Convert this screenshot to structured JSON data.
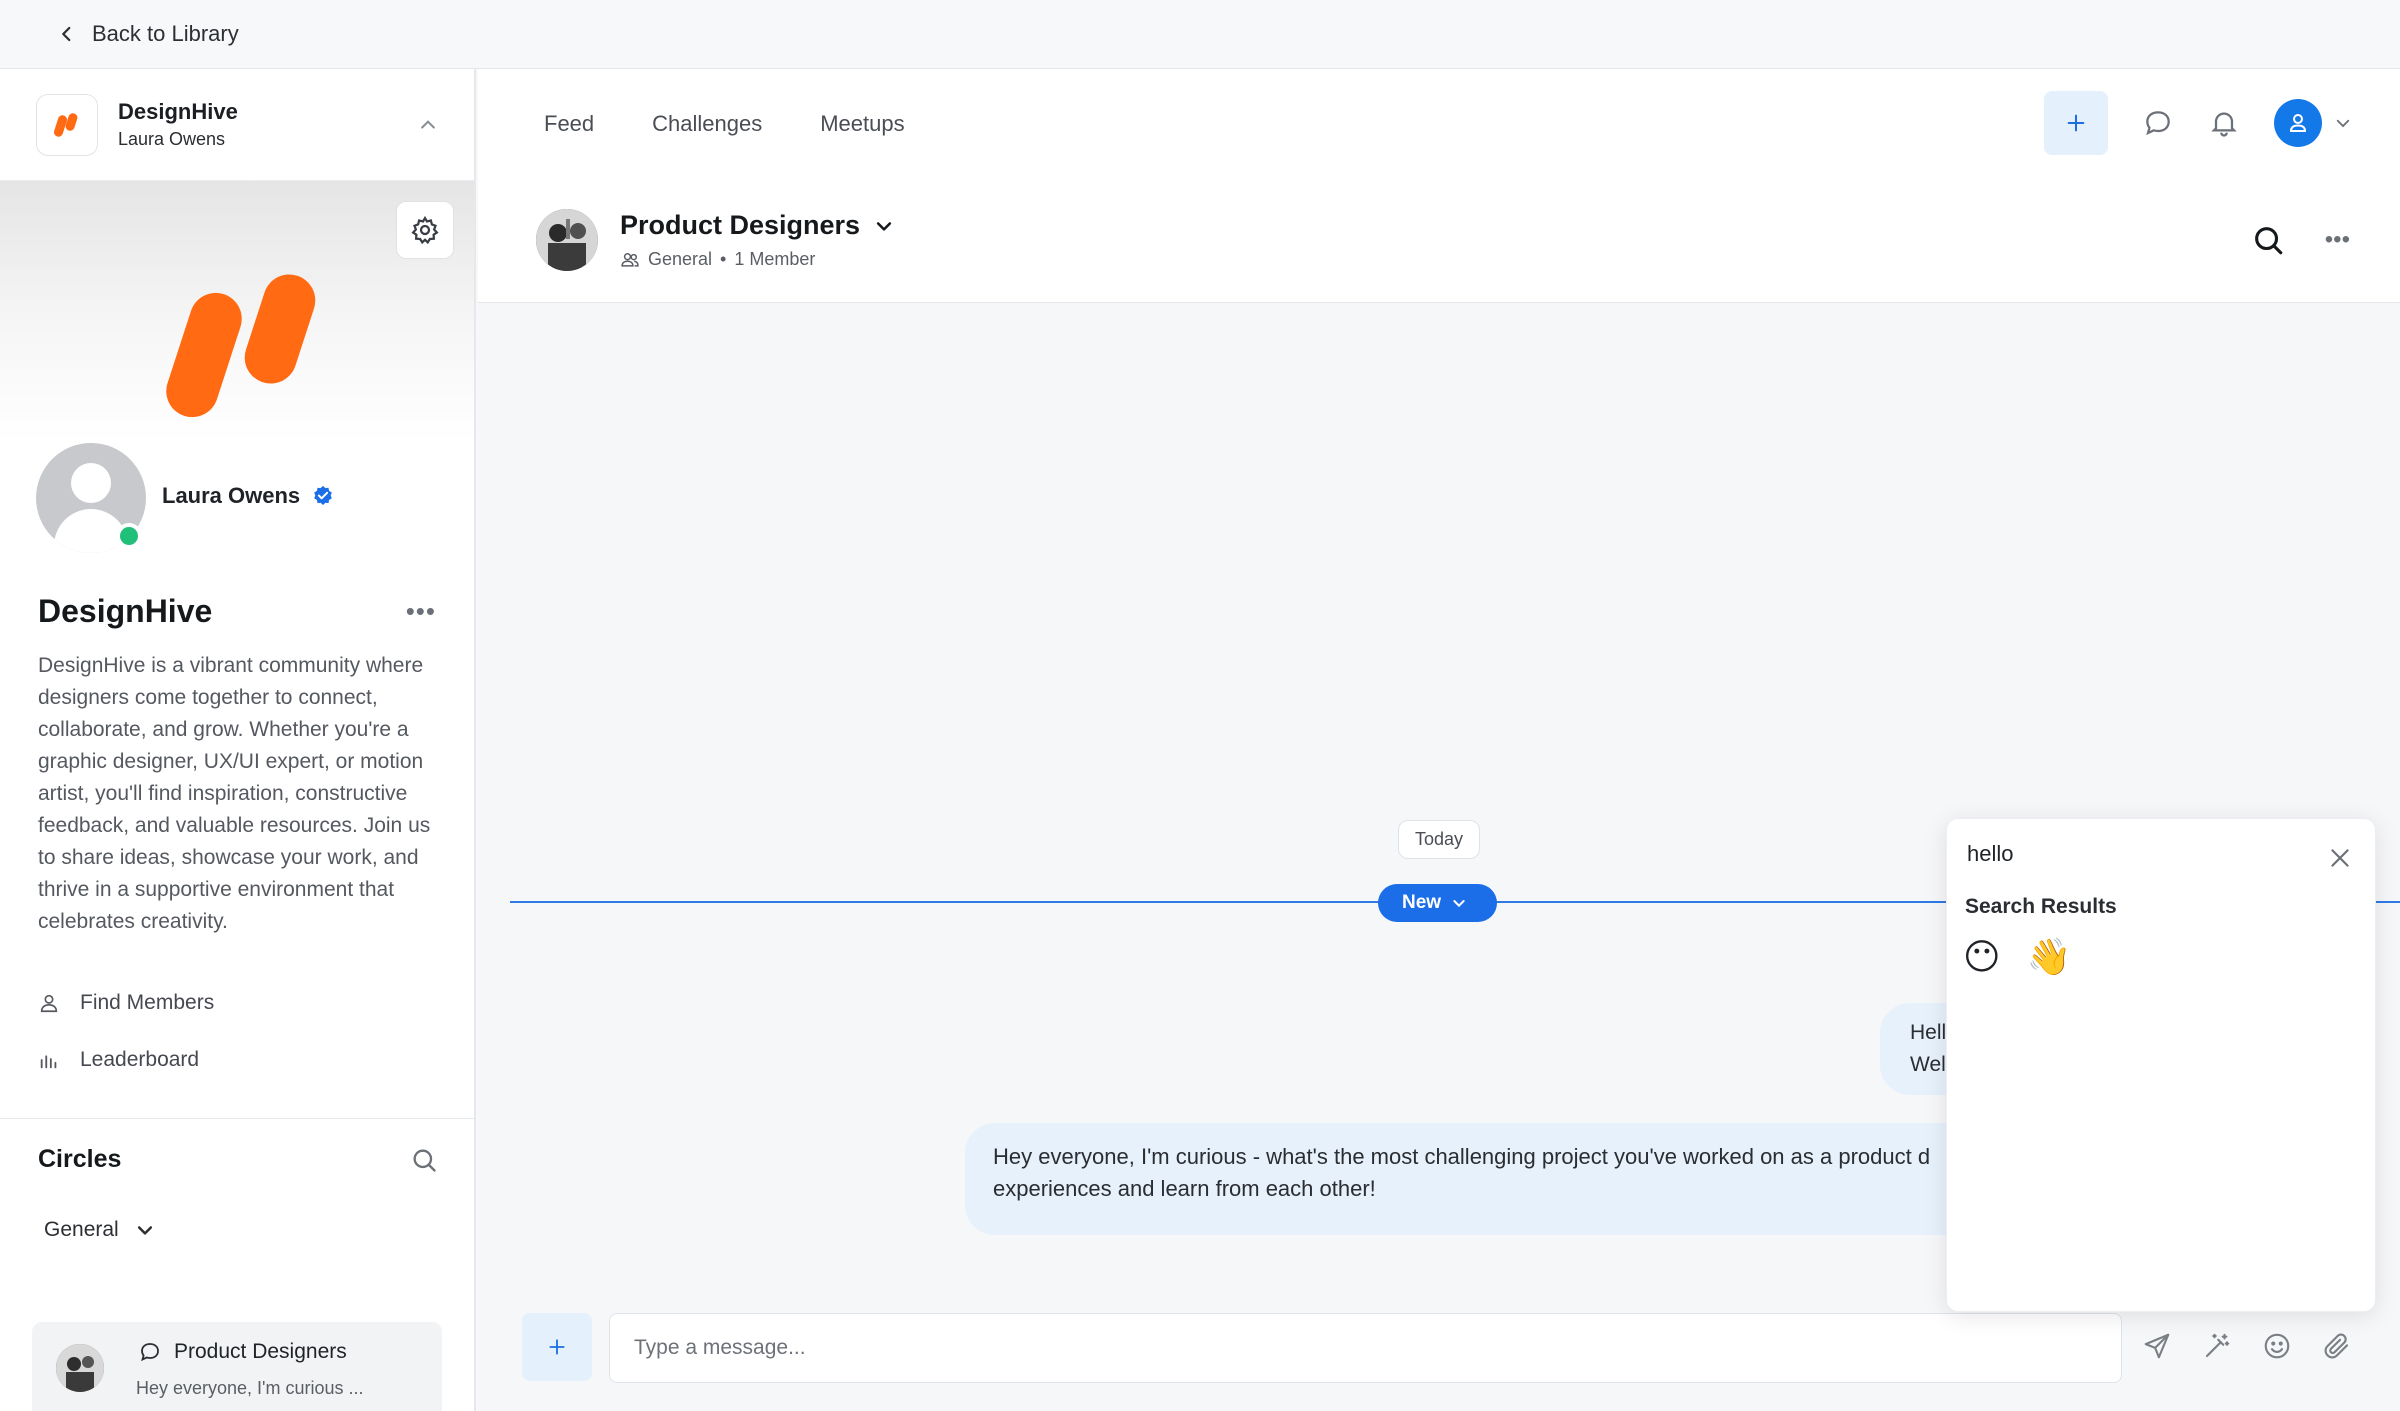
{
  "topbar": {
    "back_label": "Back to Library"
  },
  "community": {
    "name": "DesignHive",
    "user": "Laura Owens"
  },
  "profile": {
    "name": "Laura Owens"
  },
  "about": {
    "title": "DesignHive",
    "description": "DesignHive is a vibrant community where designers come together to connect, collaborate, and grow. Whether you're a graphic designer, UX/UI expert, or motion artist, you'll find inspiration, constructive feedback, and valuable resources. Join us to share ideas, showcase your work, and thrive in a supportive environment that celebrates creativity."
  },
  "links": [
    {
      "label": "Find Members",
      "icon": "person-icon"
    },
    {
      "label": "Leaderboard",
      "icon": "bar-chart-icon"
    }
  ],
  "circles": {
    "title": "Circles",
    "filter": "General",
    "items": [
      {
        "title": "Product Designers",
        "preview": "Hey everyone, I'm curious ..."
      }
    ]
  },
  "tabs": [
    "Feed",
    "Challenges",
    "Meetups"
  ],
  "channel": {
    "title": "Product Designers",
    "category": "General",
    "members": "1 Member"
  },
  "chat": {
    "date_label": "Today",
    "new_label": "New",
    "messages": [
      {
        "line1": "Hell",
        "line2": "Wel"
      },
      {
        "line1": "Hey everyone, I'm curious - what's the most challenging project you've worked on as a product d",
        "line2": "experiences and learn from each other!"
      }
    ]
  },
  "composer": {
    "placeholder": "Type a message..."
  },
  "emoji_search": {
    "query": "hello",
    "results_label": "Search Results",
    "results": [
      "😶",
      "👋"
    ]
  },
  "colors": {
    "brand": "#ff6a13",
    "accent": "#1b6ee8",
    "online": "#21c07a"
  }
}
